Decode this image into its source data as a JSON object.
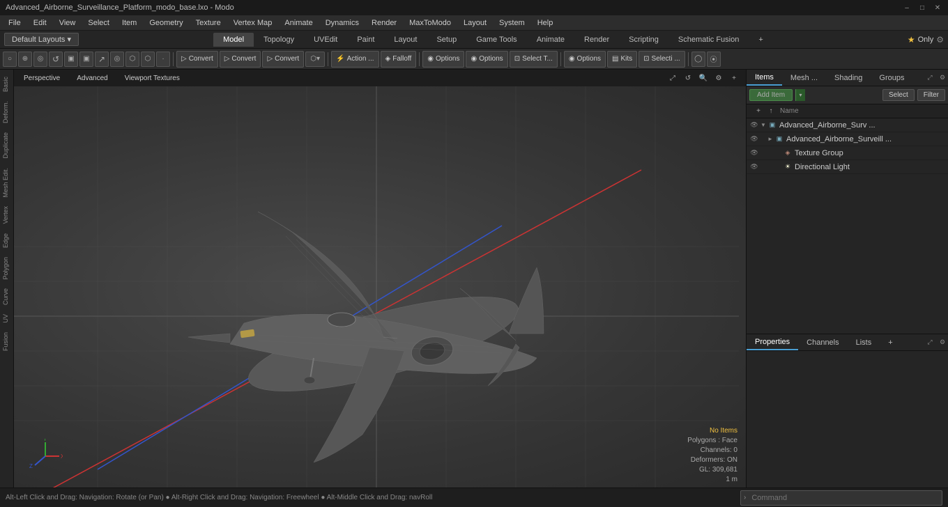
{
  "titlebar": {
    "title": "Advanced_Airborne_Surveillance_Platform_modo_base.lxo - Modo",
    "minimize": "–",
    "maximize": "□",
    "close": "✕"
  },
  "menubar": {
    "items": [
      "File",
      "Edit",
      "View",
      "Select",
      "Item",
      "Geometry",
      "Texture",
      "Vertex Map",
      "Animate",
      "Dynamics",
      "Render",
      "MaxToModo",
      "Layout",
      "System",
      "Help"
    ]
  },
  "layout": {
    "dropdown": "Default Layouts ▾",
    "tabs": [
      "Model",
      "Topology",
      "UVEdit",
      "Paint",
      "Layout",
      "Setup",
      "Game Tools",
      "Animate",
      "Render",
      "Scripting",
      "Schematic Fusion",
      "+"
    ],
    "active_tab": "Model",
    "right": {
      "star_label": "★  Only",
      "settings_icon": "⚙"
    }
  },
  "toolbar": {
    "icons": [
      "○",
      "⊕",
      "◎",
      "↺",
      "□□",
      "□□",
      "↗",
      "◎",
      "⬡",
      "⬡",
      "○"
    ],
    "convert_btn1": "Convert",
    "convert_btn2": "Convert",
    "convert_btn3": "Convert",
    "falloff_dropdown": "▾",
    "action_btn": "Action ...",
    "falloff_btn": "Falloff",
    "options_btn1": "Options",
    "options_btn2": "Options",
    "options_btn3": "Options",
    "select_t_btn": "Select T...",
    "kits_btn": "Kits",
    "select2_btn": "Selecti ...",
    "extra_icons": [
      "◯",
      "⦿"
    ]
  },
  "viewport": {
    "header": {
      "perspective_label": "Perspective",
      "advanced_label": "Advanced",
      "viewport_textures_label": "Viewport Textures"
    },
    "status": {
      "no_items": "No Items",
      "polygons_face": "Polygons : Face",
      "channels": "Channels: 0",
      "deformers": "Deformers: ON",
      "gl": "GL: 309,681",
      "scale": "1 m"
    }
  },
  "left_sidebar": {
    "tabs": [
      "Basic",
      "Deform.",
      "Duplicate",
      "Mesh Edit.",
      "Vertex",
      "Edge",
      "Polygon",
      "Curve",
      "UV",
      "Fusion"
    ]
  },
  "right_panel": {
    "items_tabs": [
      "Items",
      "Mesh ...",
      "Shading",
      "Groups"
    ],
    "active_items_tab": "Items",
    "add_item_label": "Add Item",
    "select_label": "Select",
    "filter_label": "Filter",
    "column_header": "Name",
    "tree_items": [
      {
        "id": 0,
        "depth": 0,
        "name": "Advanced_Airborne_Surv ...",
        "type": "mesh",
        "eye": true,
        "arrow": "▼",
        "selected": false
      },
      {
        "id": 1,
        "depth": 1,
        "name": "Advanced_Airborne_Surveill ...",
        "type": "mesh",
        "eye": true,
        "arrow": "►",
        "selected": false
      },
      {
        "id": 2,
        "depth": 2,
        "name": "Texture Group",
        "type": "texture",
        "eye": true,
        "arrow": "",
        "selected": false
      },
      {
        "id": 3,
        "depth": 2,
        "name": "Directional Light",
        "type": "light",
        "eye": true,
        "arrow": "",
        "selected": false
      }
    ],
    "properties_tabs": [
      "Properties",
      "Channels",
      "Lists"
    ],
    "active_prop_tab": "Properties"
  },
  "statusbar": {
    "hint": "Alt-Left Click and Drag: Navigation: Rotate (or Pan)  ●  Alt-Right Click and Drag: Navigation: Freewheel  ●  Alt-Middle Click and Drag: navRoll",
    "command_placeholder": "Command"
  }
}
